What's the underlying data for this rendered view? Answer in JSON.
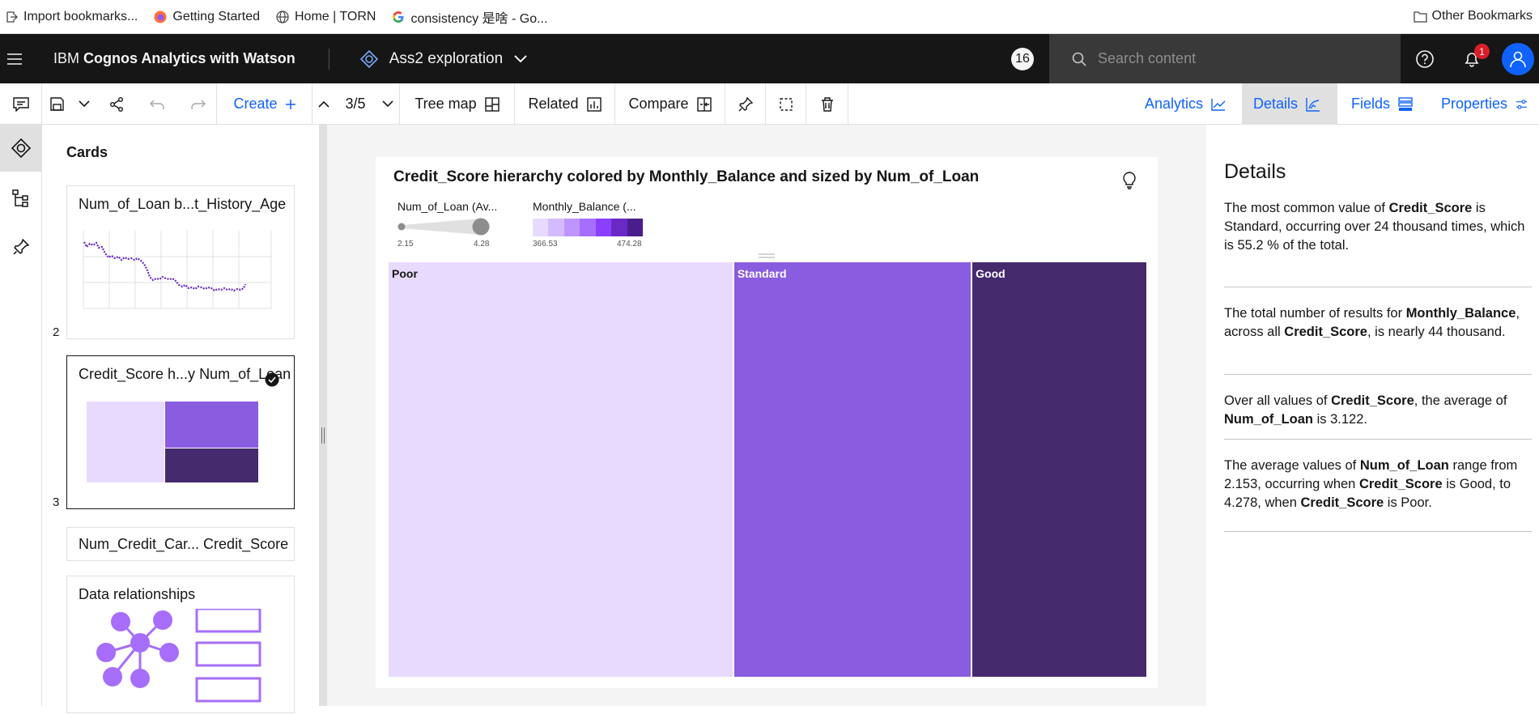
{
  "bookmarks": [
    {
      "label": "Import bookmarks...",
      "icon": "import-icon"
    },
    {
      "label": "Getting Started",
      "icon": "firefox-icon"
    },
    {
      "label": "Home | TORN",
      "icon": "globe-icon"
    },
    {
      "label": "consistency 是啥 - Go...",
      "icon": "google-icon"
    }
  ],
  "other_bookmarks": "Other Bookmarks",
  "header": {
    "brand_plain": "IBM ",
    "brand_bold": "Cognos Analytics with Watson",
    "exploration": "Ass2 exploration",
    "count_badge": "16",
    "search_placeholder": "Search content",
    "notification_count": "1"
  },
  "toolbar": {
    "create": "Create",
    "page_counter": "3/5",
    "tree_map": "Tree map",
    "related": "Related",
    "compare": "Compare",
    "tabs": [
      {
        "label": "Analytics",
        "active": false
      },
      {
        "label": "Details",
        "active": true
      },
      {
        "label": "Fields",
        "active": false
      },
      {
        "label": "Properties",
        "active": false
      }
    ]
  },
  "cards_panel": {
    "title": "Cards",
    "cards": [
      {
        "title": "Num_of_Loan b...t_History_Age",
        "number": "2"
      },
      {
        "title": "Credit_Score h...y Num_of_Loan",
        "number": "3"
      },
      {
        "title": "Num_Credit_Car... Credit_Score",
        "number": ""
      },
      {
        "title": "Data relationships",
        "number": ""
      }
    ]
  },
  "visualization": {
    "title": "Credit_Score hierarchy colored by Monthly_Balance and sized by Num_of_Loan",
    "size_legend": {
      "label": "Num_of_Loan (Av...",
      "min": "2.15",
      "max": "4.28"
    },
    "color_legend": {
      "label": "Monthly_Balance (...",
      "min": "366.53",
      "max": "474.28"
    },
    "colors": {
      "poor": "#e8daff",
      "standard": "#8a5ce0",
      "good": "#452a6e"
    }
  },
  "chart_data": {
    "type": "treemap",
    "title": "Credit_Score hierarchy colored by Monthly_Balance and sized by Num_of_Loan",
    "categories": [
      "Poor",
      "Standard",
      "Good"
    ],
    "size_values": [
      4.278,
      2.95,
      2.153
    ],
    "size_range": [
      2.15,
      4.28
    ],
    "color_range": [
      366.53,
      474.28
    ]
  },
  "details": {
    "title": "Details",
    "insights": [
      [
        {
          "t": "The most common value of "
        },
        {
          "b": "Credit_Score"
        },
        {
          "t": " is Standard, occurring over 24 thousand times, which is 55.2 % of the total."
        }
      ],
      [
        {
          "t": "The total number of results for "
        },
        {
          "b": "Monthly_Balance"
        },
        {
          "t": ", across all "
        },
        {
          "b": "Credit_Score"
        },
        {
          "t": ", is nearly 44 thousand."
        }
      ],
      [
        {
          "t": "Over all values of "
        },
        {
          "b": "Credit_Score"
        },
        {
          "t": ", the average of "
        },
        {
          "b": "Num_of_Loan"
        },
        {
          "t": " is 3.122."
        }
      ],
      [
        {
          "t": "The average values of "
        },
        {
          "b": "Num_of_Loan"
        },
        {
          "t": " range from 2.153, occurring when "
        },
        {
          "b": "Credit_Score"
        },
        {
          "t": " is Good, to 4.278, when "
        },
        {
          "b": "Credit_Score"
        },
        {
          "t": " is Poor."
        }
      ]
    ]
  }
}
